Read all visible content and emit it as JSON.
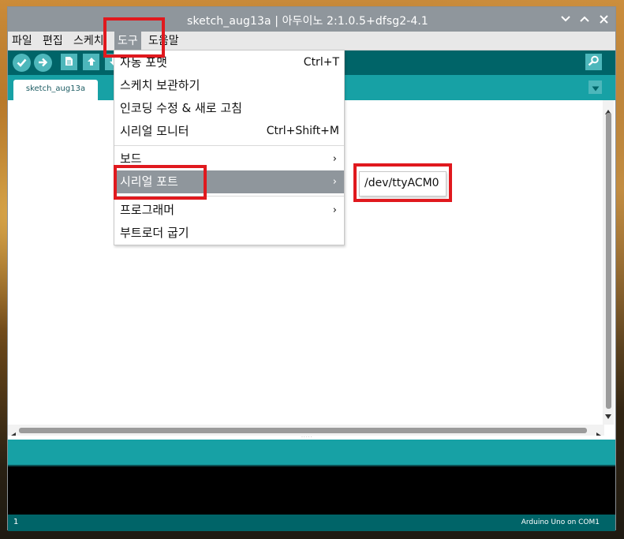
{
  "window": {
    "title": "sketch_aug13a | 아두이노 2:1.0.5+dfsg2-4.1",
    "controls": [
      "chevron-down-icon",
      "chevron-up-icon",
      "close-icon"
    ]
  },
  "menubar": {
    "items": [
      "파일",
      "편집",
      "스케치",
      "도구",
      "도움말"
    ],
    "active": "도구"
  },
  "toolbar": {
    "buttons": [
      "verify-icon",
      "upload-icon",
      "new-icon",
      "open-icon",
      "save-icon",
      "serial-monitor-icon"
    ]
  },
  "tabs": {
    "items": [
      {
        "label": "sketch_aug13a"
      }
    ]
  },
  "tools_menu": {
    "items": [
      {
        "label": "자동 포맷",
        "shortcut": "Ctrl+T"
      },
      {
        "label": "스케치 보관하기",
        "shortcut": ""
      },
      {
        "label": "인코딩 수정 & 새로 고침",
        "shortcut": ""
      },
      {
        "label": "시리얼 모니터",
        "shortcut": "Ctrl+Shift+M"
      },
      {
        "label": "보드",
        "arrow": "›"
      },
      {
        "label": "시리얼 포트",
        "arrow": "›"
      },
      {
        "label": "프로그래머",
        "arrow": "›"
      },
      {
        "label": "부트로더 굽기"
      }
    ],
    "highlighted": "시리얼 포트"
  },
  "serial_port_submenu": {
    "items": [
      "/dev/ttyACM0"
    ]
  },
  "footer": {
    "line": "1",
    "board": "Arduino Uno on COM1"
  },
  "annotation": {
    "color": "#e0191e"
  },
  "colors": {
    "teal_dark": "#006468",
    "teal": "#17a1a5",
    "teal_light": "#4db7bb",
    "menu_highlight": "#8f969c"
  }
}
